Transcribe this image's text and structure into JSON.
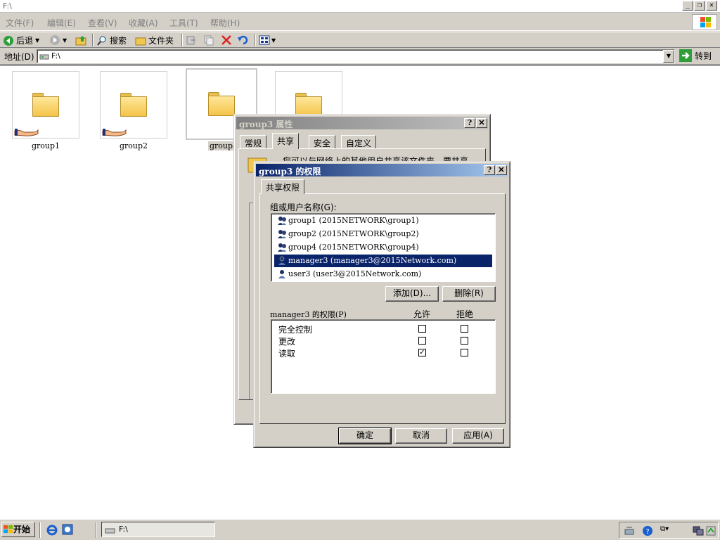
{
  "window": {
    "title": "F:\\"
  },
  "menu": [
    "文件(F)",
    "编辑(E)",
    "查看(V)",
    "收藏(A)",
    "工具(T)",
    "帮助(H)"
  ],
  "toolbar": {
    "back": "后退",
    "search": "搜索",
    "folders": "文件夹"
  },
  "address": {
    "label": "地址(D)",
    "value": "F:\\",
    "go": "转到"
  },
  "folders": [
    {
      "name": "group1",
      "shared": true
    },
    {
      "name": "group2",
      "shared": true
    },
    {
      "name": "group3",
      "shared": false,
      "selected": true
    },
    {
      "name": "",
      "shared": false
    }
  ],
  "properties_dialog": {
    "title": "group3 属性",
    "tabs": [
      "常规",
      "共享",
      "安全",
      "自定义"
    ],
    "active_tab": "共享",
    "partial_text": "您可以与网络上的其他用户共享该文件夹。要共享"
  },
  "permissions_dialog": {
    "title": "group3 的权限",
    "tab": "共享权限",
    "users_label": "组或用户名称(G):",
    "users": [
      {
        "name": "group1 (2015NETWORK\\group1)",
        "icon": "group-icon"
      },
      {
        "name": "group2 (2015NETWORK\\group2)",
        "icon": "group-icon"
      },
      {
        "name": "group4 (2015NETWORK\\group4)",
        "icon": "group-icon"
      },
      {
        "name": "manager3 (manager3@2015Network.com)",
        "icon": "user-icon",
        "selected": true
      },
      {
        "name": "user3 (user3@2015Network.com)",
        "icon": "user-icon"
      }
    ],
    "add_button": "添加(D)...",
    "remove_button": "删除(R)",
    "perm_label": "manager3 的权限(P)",
    "allow_col": "允许",
    "deny_col": "拒绝",
    "permissions": [
      {
        "name": "完全控制",
        "allow": false,
        "deny": false
      },
      {
        "name": "更改",
        "allow": false,
        "deny": false
      },
      {
        "name": "读取",
        "allow": true,
        "deny": false
      }
    ],
    "ok": "确定",
    "cancel": "取消",
    "apply": "应用(A)"
  },
  "taskbar": {
    "start": "开始",
    "task": "F:\\"
  }
}
